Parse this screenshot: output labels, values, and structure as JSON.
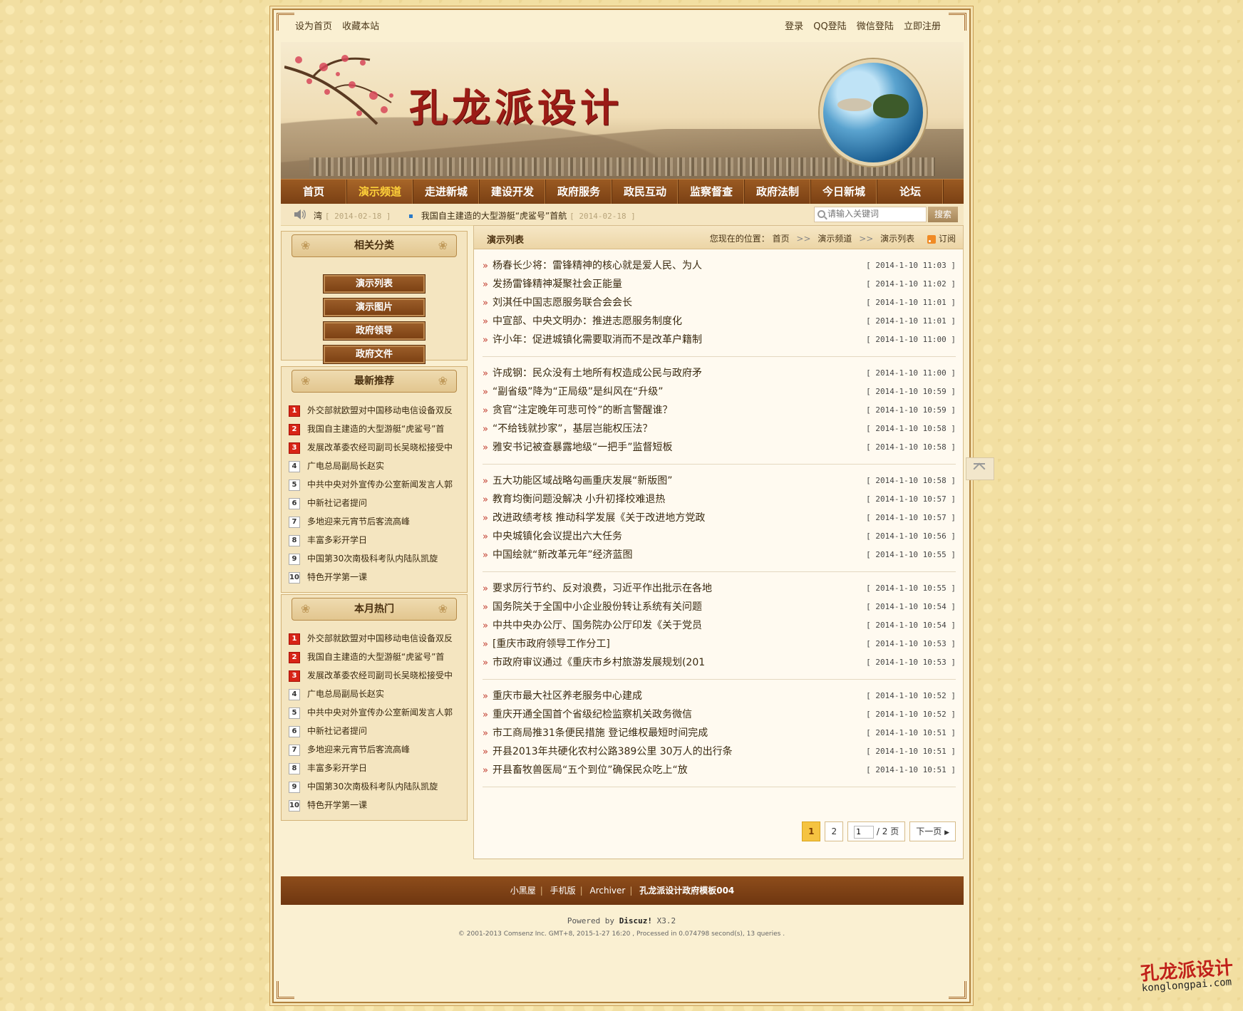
{
  "topbar": {
    "left": [
      "设为首页",
      "收藏本站"
    ],
    "right": [
      "登录",
      "QQ登陆",
      "微信登陆",
      "立即注册"
    ]
  },
  "banner": {
    "site_name": "孔龙派设计"
  },
  "nav": {
    "items": [
      "首页",
      "演示频道",
      "走进新城",
      "建设开发",
      "政府服务",
      "政民互动",
      "监察督查",
      "政府法制",
      "今日新城",
      "论坛"
    ],
    "active_index": 1
  },
  "ticker": {
    "item1": "湾",
    "date1": "[ 2014-02-18 ]",
    "item2": "我国自主建造的大型游艇“虎鲨号”首航",
    "date2": "[ 2014-02-18 ]"
  },
  "search": {
    "placeholder": "请输入关键词",
    "button": "搜索"
  },
  "sidebar": {
    "categories_title": "相关分类",
    "categories": [
      "演示列表",
      "演示图片",
      "政府领导",
      "政府文件"
    ],
    "latest_title": "最新推荐",
    "hot_title": "本月热门",
    "rank_items": [
      "外交部就欧盟对中国移动电信设备双反",
      "我国自主建造的大型游艇“虎鲨号”首",
      "发展改革委农经司副司长吴晓松接受中",
      "广电总局副局长赵实",
      "中共中央对外宣传办公室新闻发言人郭",
      "中新社记者提问",
      "多地迎来元宵节后客流高峰",
      "丰富多彩开学日",
      "中国第30次南极科考队内陆队凯旋",
      "特色开学第一课"
    ]
  },
  "main": {
    "title": "演示列表",
    "breadcrumb_prefix": "您现在的位置：",
    "breadcrumb": [
      "首页",
      "演示频道",
      "演示列表"
    ],
    "subscribe": "订阅",
    "groups": [
      [
        {
          "title": "杨春长少将：雷锋精神的核心就是爱人民、为人",
          "date": "[ 2014-1-10 11:03 ]"
        },
        {
          "title": "发扬雷锋精神凝聚社会正能量",
          "date": "[ 2014-1-10 11:02 ]"
        },
        {
          "title": "刘淇任中国志愿服务联合会会长",
          "date": "[ 2014-1-10 11:01 ]"
        },
        {
          "title": "中宣部、中央文明办：推进志愿服务制度化",
          "date": "[ 2014-1-10 11:01 ]"
        },
        {
          "title": "许小年：促进城镇化需要取消而不是改革户籍制",
          "date": "[ 2014-1-10 11:00 ]"
        }
      ],
      [
        {
          "title": "许成钢：民众没有土地所有权造成公民与政府矛",
          "date": "[ 2014-1-10 11:00 ]"
        },
        {
          "title": "“副省级”降为“正局级”是纠风在“升级”",
          "date": "[ 2014-1-10 10:59 ]"
        },
        {
          "title": "贪官“注定晚年可悲可怜”的断言警醒谁？",
          "date": "[ 2014-1-10 10:59 ]"
        },
        {
          "title": "“不给钱就抄家”，基层岂能权压法？",
          "date": "[ 2014-1-10 10:58 ]"
        },
        {
          "title": "雅安书记被查暴露地级“一把手”监督短板",
          "date": "[ 2014-1-10 10:58 ]"
        }
      ],
      [
        {
          "title": "五大功能区域战略勾画重庆发展“新版图”",
          "date": "[ 2014-1-10 10:58 ]"
        },
        {
          "title": "教育均衡问题没解决 小升初择校难退热",
          "date": "[ 2014-1-10 10:57 ]"
        },
        {
          "title": "改进政绩考核 推动科学发展《关于改进地方党政",
          "date": "[ 2014-1-10 10:57 ]"
        },
        {
          "title": "中央城镇化会议提出六大任务",
          "date": "[ 2014-1-10 10:56 ]"
        },
        {
          "title": "中国绘就“新改革元年”经济蓝图",
          "date": "[ 2014-1-10 10:55 ]"
        }
      ],
      [
        {
          "title": "要求厉行节约、反对浪费，习近平作出批示在各地",
          "date": "[ 2014-1-10 10:55 ]"
        },
        {
          "title": "国务院关于全国中小企业股份转让系统有关问题",
          "date": "[ 2014-1-10 10:54 ]"
        },
        {
          "title": "中共中央办公厅、国务院办公厅印发《关于党员",
          "date": "[ 2014-1-10 10:54 ]"
        },
        {
          "title": "[重庆市政府领导工作分工]",
          "date": "[ 2014-1-10 10:53 ]"
        },
        {
          "title": "市政府审议通过《重庆市乡村旅游发展规划(201",
          "date": "[ 2014-1-10 10:53 ]"
        }
      ],
      [
        {
          "title": "重庆市最大社区养老服务中心建成",
          "date": "[ 2014-1-10 10:52 ]"
        },
        {
          "title": "重庆开通全国首个省级纪检监察机关政务微信",
          "date": "[ 2014-1-10 10:52 ]"
        },
        {
          "title": "市工商局推31条便民措施 登记维权最短时间完成",
          "date": "[ 2014-1-10 10:51 ]"
        },
        {
          "title": "开县2013年共硬化农村公路389公里 30万人的出行条",
          "date": "[ 2014-1-10 10:51 ]"
        },
        {
          "title": "开县畜牧兽医局“五个到位”确保民众吃上“放",
          "date": "[ 2014-1-10 10:51 ]"
        }
      ]
    ],
    "pager": {
      "page1": "1",
      "page2": "2",
      "input_value": "1",
      "total": "/ 2 页",
      "next": "下一页"
    }
  },
  "footer": {
    "links": [
      "小黑屋",
      "手机版",
      "Archiver"
    ],
    "site": "孔龙派设计政府模板004",
    "powered_prefix": "Powered by ",
    "powered_brand": "Discuz!",
    "powered_version": " X3.2",
    "copyright": "© 2001-2013 Comsenz Inc.  GMT+8, 2015-1-27 16:20 , Processed in 0.074798 second(s), 13 queries ."
  },
  "watermark": {
    "zh": "孔龙派设计",
    "en": "konglongpai.com"
  }
}
